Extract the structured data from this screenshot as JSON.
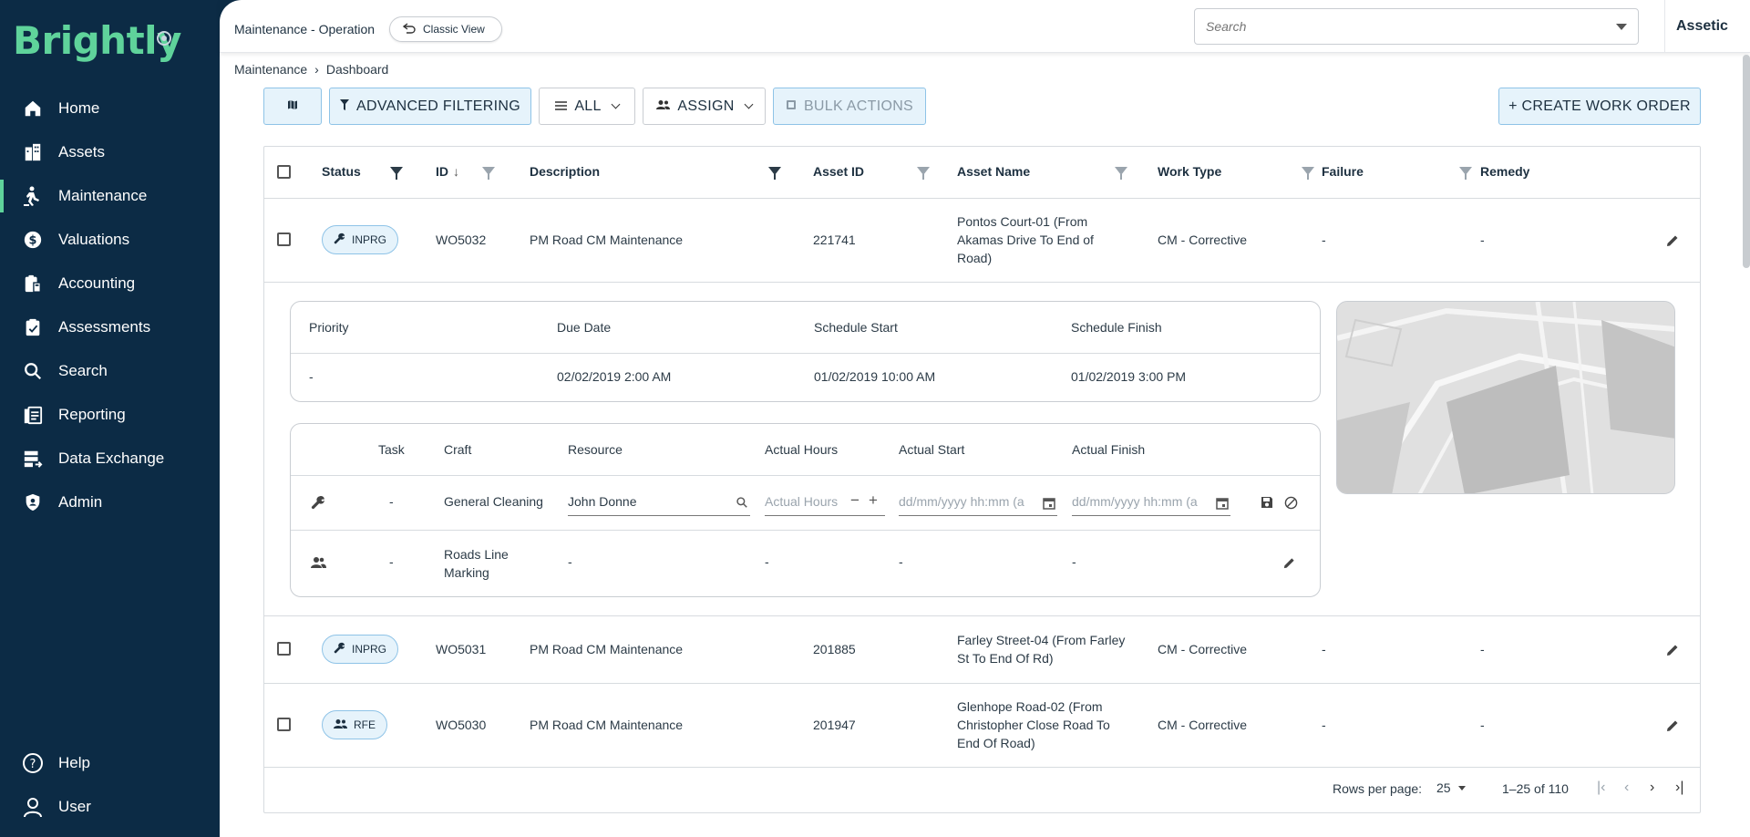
{
  "brand": {
    "logo_text": "Brightly",
    "accent": "#5fd39b",
    "sidebar_bg": "#0c2b45"
  },
  "sidebar": {
    "items": [
      {
        "label": "Home",
        "icon": "home-icon"
      },
      {
        "label": "Assets",
        "icon": "building-icon"
      },
      {
        "label": "Maintenance",
        "icon": "worker-icon",
        "active": true
      },
      {
        "label": "Valuations",
        "icon": "currency-icon"
      },
      {
        "label": "Accounting",
        "icon": "clipboard-icon"
      },
      {
        "label": "Assessments",
        "icon": "assessment-icon"
      },
      {
        "label": "Search",
        "icon": "search-icon"
      },
      {
        "label": "Reporting",
        "icon": "report-icon"
      },
      {
        "label": "Data Exchange",
        "icon": "data-exchange-icon"
      },
      {
        "label": "Admin",
        "icon": "shield-icon"
      }
    ],
    "bottom": [
      {
        "label": "Help",
        "icon": "help-icon"
      },
      {
        "label": "User",
        "icon": "user-icon"
      }
    ]
  },
  "topbar": {
    "title": "Maintenance - Operation",
    "classic_view": "Classic View",
    "search_placeholder": "Search",
    "org": "Assetic"
  },
  "breadcrumb": {
    "items": [
      "Maintenance",
      "Dashboard"
    ],
    "separator": "›"
  },
  "toolbar": {
    "advanced_filtering": "ADVANCED FILTERING",
    "all": "ALL",
    "assign": "ASSIGN",
    "bulk_actions": "BULK ACTIONS",
    "create_work_order": "+ CREATE WORK ORDER"
  },
  "table": {
    "columns": {
      "status": "Status",
      "id": "ID",
      "description": "Description",
      "asset_id": "Asset ID",
      "asset_name": "Asset Name",
      "work_type": "Work Type",
      "failure": "Failure",
      "remedy": "Remedy"
    },
    "rows": [
      {
        "status": "INPRG",
        "id": "WO5032",
        "description": "PM Road CM Maintenance",
        "asset_id": "221741",
        "asset_name_lines": [
          "Pontos Court-01 (From",
          "Akamas Drive To End of",
          "Road)"
        ],
        "work_type": "CM - Corrective",
        "failure": "-",
        "remedy": "-"
      },
      {
        "status": "INPRG",
        "id": "WO5031",
        "description": "PM Road CM Maintenance",
        "asset_id": "201885",
        "asset_name_lines": [
          "Farley Street-04 (From Farley",
          "St To End Of Rd)"
        ],
        "work_type": "CM - Corrective",
        "failure": "-",
        "remedy": "-"
      },
      {
        "status": "RFE",
        "id": "WO5030",
        "description": "PM Road CM Maintenance",
        "asset_id": "201947",
        "asset_name_lines": [
          "Glenhope Road-02 (From",
          "Christopher Close Road To",
          "End Of Road)"
        ],
        "work_type": "CM - Corrective",
        "failure": "-",
        "remedy": "-"
      }
    ]
  },
  "detail": {
    "schedule": {
      "headers": {
        "priority": "Priority",
        "due_date": "Due Date",
        "schedule_start": "Schedule Start",
        "schedule_finish": "Schedule Finish"
      },
      "values": {
        "priority": "-",
        "due_date": "02/02/2019 2:00 AM",
        "schedule_start": "01/02/2019 10:00 AM",
        "schedule_finish": "01/02/2019 3:00 PM"
      }
    },
    "labour": {
      "headers": {
        "task": "Task",
        "craft": "Craft",
        "resource": "Resource",
        "actual_hours": "Actual Hours",
        "actual_start": "Actual Start",
        "actual_finish": "Actual Finish"
      },
      "edit_row": {
        "task": "-",
        "craft": "General Cleaning",
        "resource": "John Donne",
        "hours_placeholder": "Actual Hours",
        "start_placeholder": "dd/mm/yyyy hh:mm (a",
        "finish_placeholder": "dd/mm/yyyy hh:mm (a"
      },
      "row2": {
        "task": "-",
        "craft_lines": [
          "Roads Line",
          "Marking"
        ],
        "resource": "-",
        "actual_hours": "-",
        "actual_start": "-",
        "actual_finish": "-"
      }
    }
  },
  "pagination": {
    "rows_per_page_label": "Rows per page:",
    "rows_per_page": "25",
    "range": "1–25 of 110"
  }
}
